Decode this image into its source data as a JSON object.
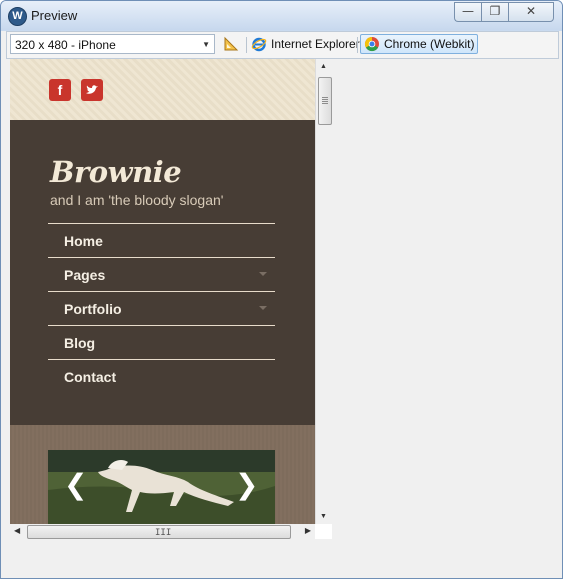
{
  "window": {
    "title": "Preview",
    "app_icon": "W",
    "controls": {
      "minimize": "—",
      "maximize": "❐",
      "close": "✕"
    }
  },
  "toolbar": {
    "device": "320 x 480 - iPhone",
    "browsers": [
      {
        "label": "Internet Explorer",
        "icon": "ie-icon",
        "active": false
      },
      {
        "label": "Chrome (Webkit)",
        "icon": "chrome-icon",
        "active": true
      }
    ]
  },
  "site": {
    "social": [
      "f",
      "t"
    ],
    "logo": "Brownie",
    "slogan": "and I am 'the bloody slogan'",
    "menu": [
      {
        "label": "Home",
        "has_submenu": false
      },
      {
        "label": "Pages",
        "has_submenu": true
      },
      {
        "label": "Portfolio",
        "has_submenu": true
      },
      {
        "label": "Blog",
        "has_submenu": false
      },
      {
        "label": "Contact",
        "has_submenu": false
      }
    ],
    "slider": {
      "prev": "❮",
      "next": "❯"
    }
  },
  "scrollbars": {
    "h_grip": "III"
  }
}
